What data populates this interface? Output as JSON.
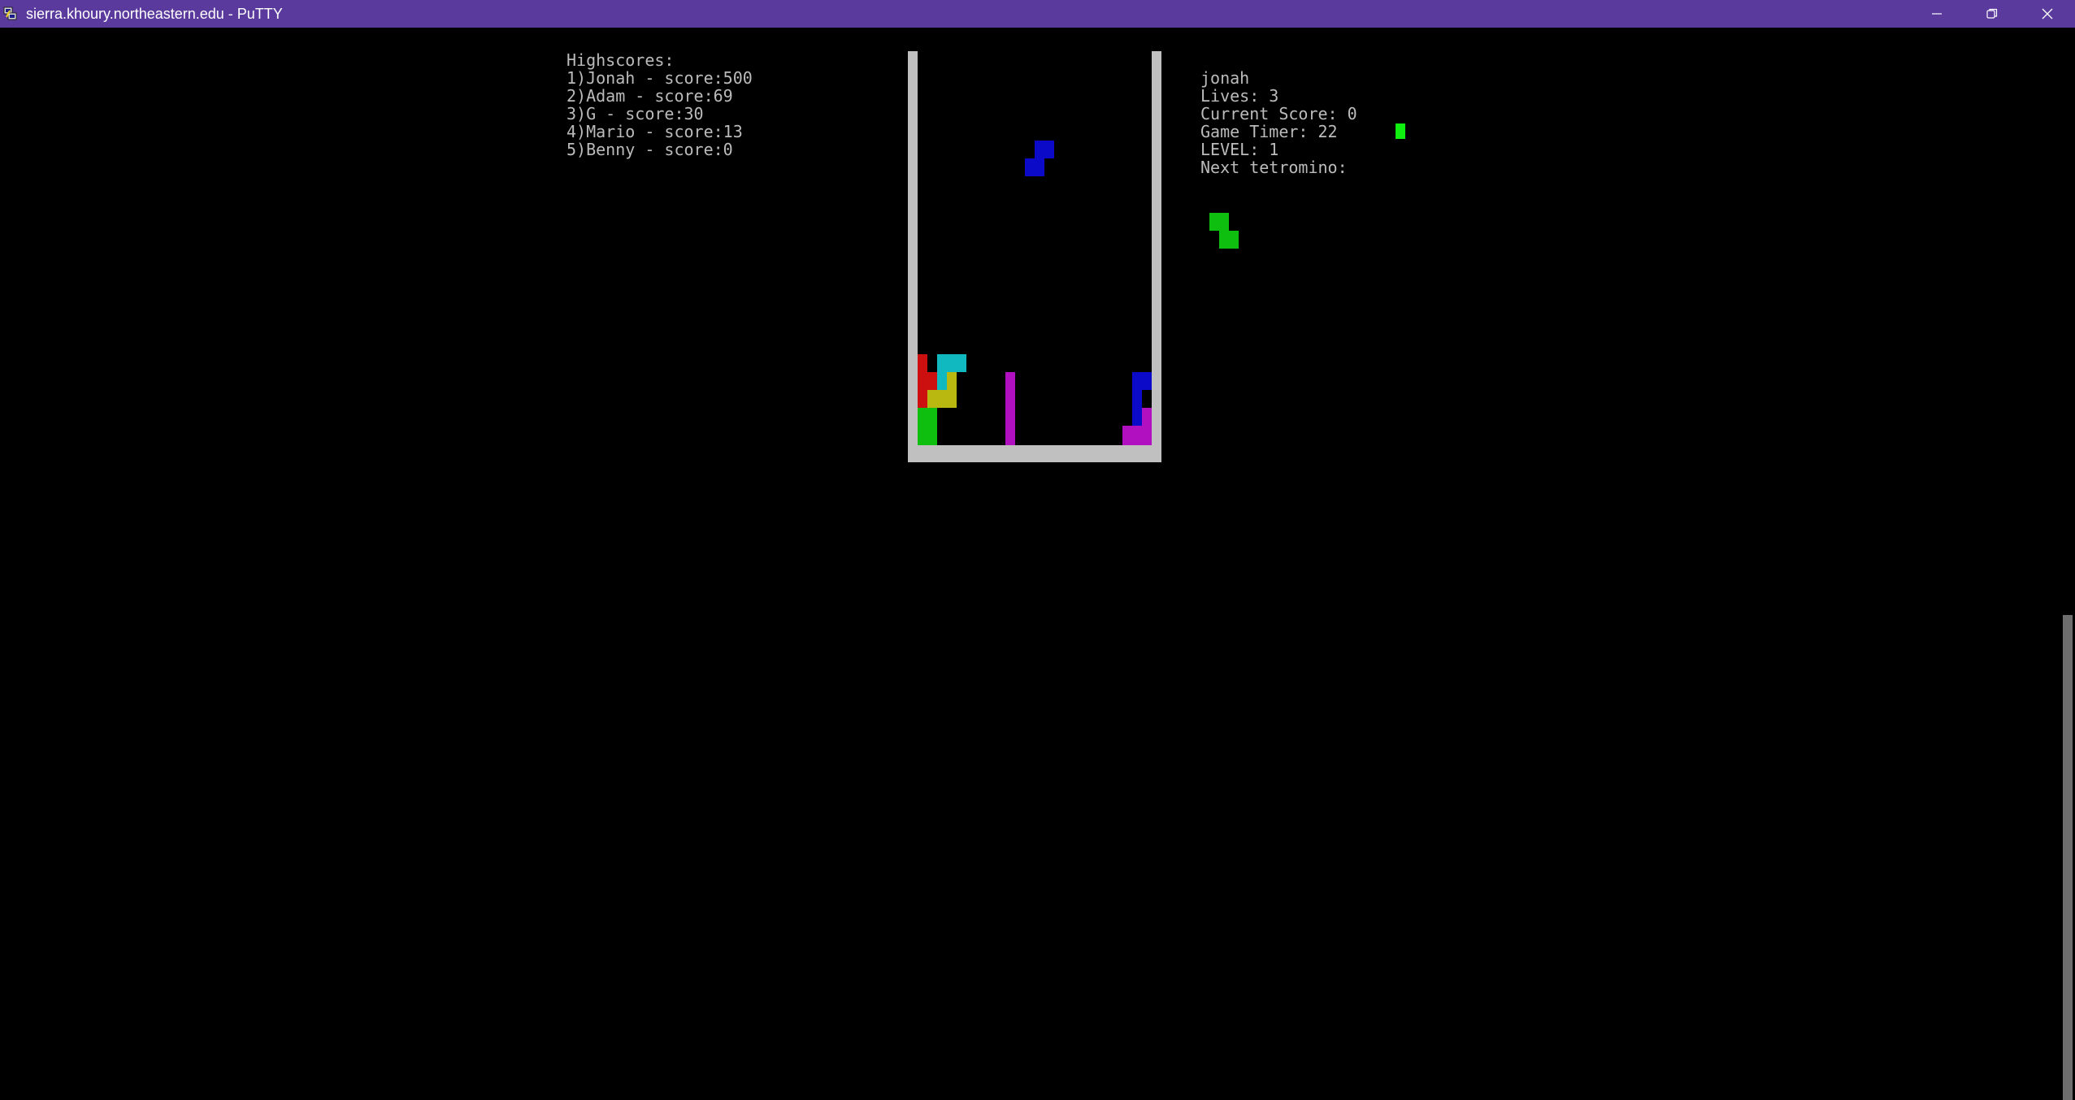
{
  "window": {
    "title": "sierra.khoury.northeastern.edu - PuTTY",
    "icon": "putty-icon",
    "titlebar_color": "#5b3a9e",
    "controls": [
      "minimize-icon",
      "restore-icon",
      "close-icon"
    ]
  },
  "highscores": {
    "heading": "Highscores:",
    "entries": [
      "1)Jonah - score:500",
      "2)Adam - score:69",
      "3)G - score:30",
      "4)Mario - score:13",
      "5)Benny - score:0"
    ]
  },
  "player": {
    "name": "jonah",
    "lives_line": "Lives: 3",
    "score_line": "Current Score: 0",
    "timer_line": "Game Timer: 22",
    "level_line": "LEVEL: 1",
    "next_label": "Next tetromino:"
  },
  "colors": {
    "text": "#bbbbbb",
    "well_wall": "#c0c0c0",
    "red": "#cc1010",
    "green": "#0fbf10",
    "cyan": "#10b8c0",
    "yellow": "#b8b810",
    "magenta": "#b010c0",
    "blue": "#0a0ac8",
    "bright_green": "#10f010"
  }
}
